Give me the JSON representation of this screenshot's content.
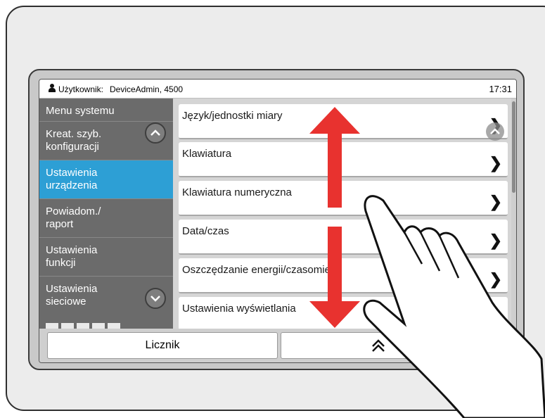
{
  "topbar": {
    "user_label": "Użytkownik:",
    "user_value": "DeviceAdmin, 4500",
    "time": "17:31"
  },
  "sidebar": {
    "title": "Menu systemu",
    "items": [
      {
        "label": "Kreat. szyb. konfiguracji",
        "active": false
      },
      {
        "label": "Ustawienia urządzenia",
        "active": true
      },
      {
        "label": "Powiadom./ raport",
        "active": false
      },
      {
        "label": "Ustawienia funkcji",
        "active": false
      },
      {
        "label": "Ustawienia sieciowe",
        "active": false
      }
    ]
  },
  "main": {
    "rows": [
      {
        "label": "Język/jednostki miary"
      },
      {
        "label": "Klawiatura"
      },
      {
        "label": "Klawiatura numeryczna"
      },
      {
        "label": "Data/czas"
      },
      {
        "label": "Oszczędzanie energii/czasomierz"
      },
      {
        "label": "Ustawienia wyświetlania"
      }
    ]
  },
  "bottom": {
    "counter_label": "Licznik"
  },
  "icons": {
    "user": "user-icon",
    "up": "chevron-up-icon",
    "down": "chevron-down-icon",
    "row": "chevron-right-icon",
    "home": "double-chevron-up-icon",
    "gesture": "swipe-hand-icon",
    "arrow": "vertical-double-arrow-icon"
  },
  "colors": {
    "accent": "#2d9fd5",
    "sidebar": "#6b6b6b",
    "arrow": "#e8322f"
  }
}
